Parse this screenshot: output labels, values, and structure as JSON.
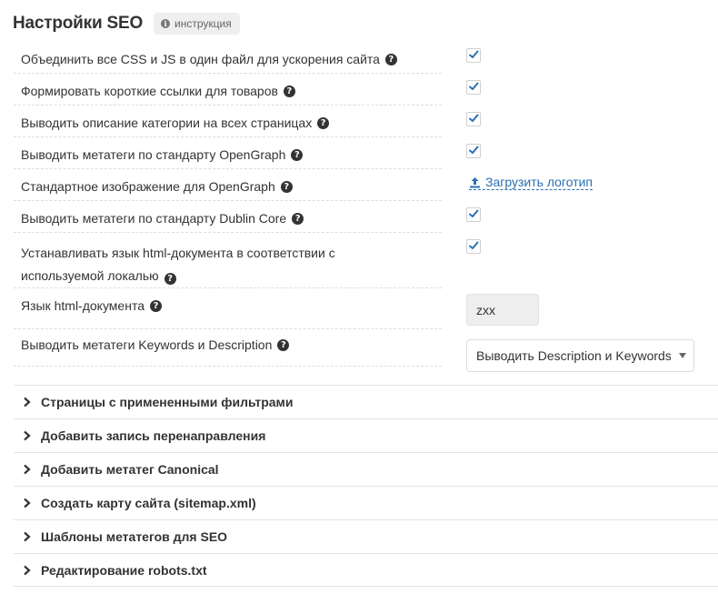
{
  "header": {
    "title": "Настройки SEO",
    "help_label": "инструкция"
  },
  "settings": [
    {
      "label": "Объединить все CSS и JS в один файл для ускорения сайта",
      "control": "checkbox",
      "checked": true
    },
    {
      "label": "Формировать короткие ссылки для товаров",
      "control": "checkbox",
      "checked": true
    },
    {
      "label": "Выводить описание категории на всех страницах",
      "control": "checkbox",
      "checked": true
    },
    {
      "label": "Выводить метатеги по стандарту OpenGraph",
      "control": "checkbox",
      "checked": true
    },
    {
      "label": "Стандартное изображение для OpenGraph",
      "control": "link",
      "link_label": "Загрузить логотип"
    },
    {
      "label": "Выводить метатеги по стандарту Dublin Core",
      "control": "checkbox",
      "checked": true
    },
    {
      "label_line1": "Устанавливать язык html-документа в соответствии с",
      "label_line2": "используемой локалью",
      "control": "checkbox",
      "checked": true
    },
    {
      "label": "Язык html-документа",
      "control": "input",
      "value": "zxx"
    },
    {
      "label": "Выводить метатеги Keywords и Description",
      "control": "select",
      "selected": "Выводить Description и Keywords"
    }
  ],
  "sections": [
    "Страницы с примененными фильтрами",
    "Добавить запись перенаправления",
    "Добавить метатег Canonical",
    "Создать карту сайта (sitemap.xml)",
    "Шаблоны метатегов для SEO",
    "Редактирование robots.txt"
  ],
  "colors": {
    "link": "#2a6fb5",
    "check": "#2a6fb5"
  },
  "icons": {
    "help": "question-circle-icon",
    "info": "info-circle-icon",
    "upload": "upload-icon",
    "chevron": "chevron-right-icon"
  }
}
